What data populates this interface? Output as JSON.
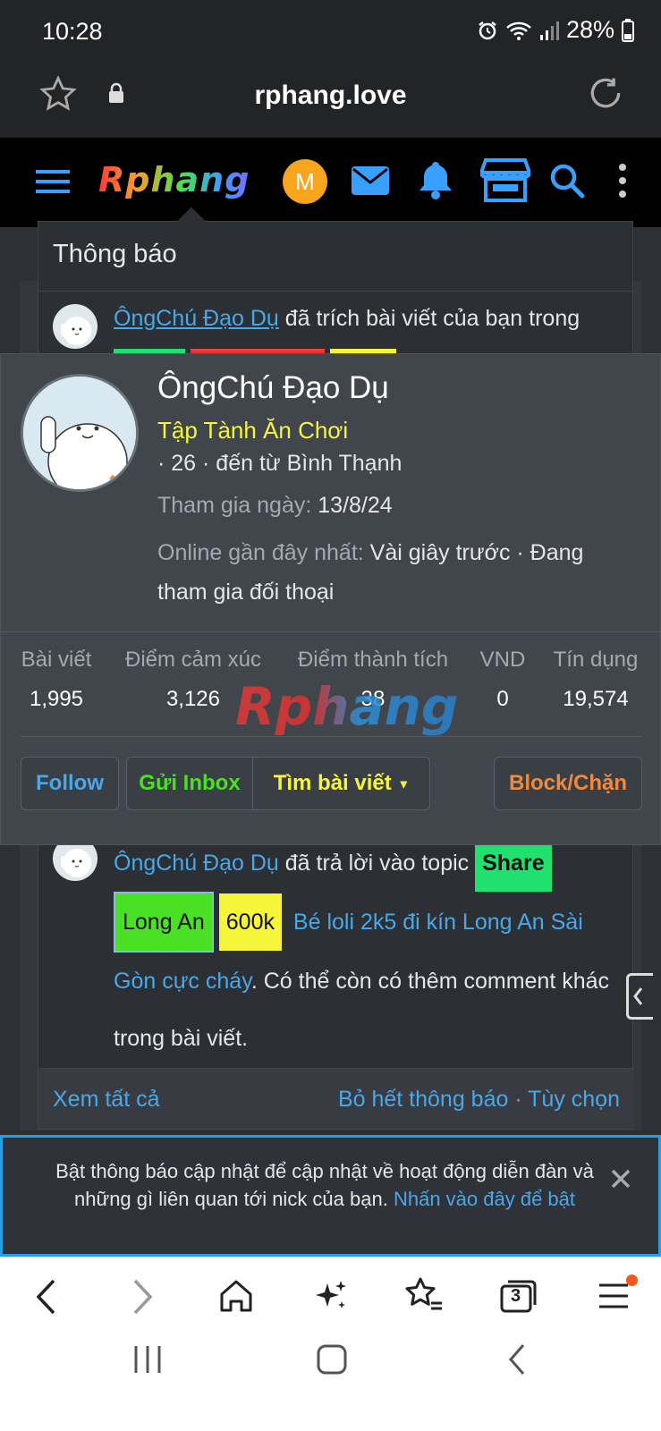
{
  "status": {
    "time": "10:28",
    "battery": "28%"
  },
  "browser": {
    "url": "rphang.love"
  },
  "site": {
    "logo": "Rphang",
    "avatar_letter": "M"
  },
  "notifications": {
    "title": "Thông báo",
    "item1": {
      "user": "ÔngChú Đạo Dụ",
      "text": " đã trích bài viết của bạn trong"
    },
    "item2": {
      "user": "ÔngChú Đạo Dụ",
      "text1": " đã trả lời vào topic ",
      "tag_share": "Share",
      "tag_longan": "Long An",
      "tag_600k": "600k",
      "link": " Bé loli 2k5 đi kín Long An Sài Gòn cực cháy",
      "text2": ". Có thể còn có thêm comment khác trong bài viết."
    },
    "footer": {
      "view_all": "Xem tất cả",
      "dismiss_all": "Bỏ hết thông báo",
      "sep": " · ",
      "options": "Tùy chọn"
    }
  },
  "profile": {
    "name": "ÔngChú Đạo Dụ",
    "rank": "Tập Tành Ăn Chơi",
    "age_location": "· 26 · đến từ Bình Thạnh",
    "joined_label": "Tham gia ngày:",
    "joined_value": " 13/8/24",
    "online_label": "Online gần đây nhất:",
    "online_value": " Vài giây trước · Đang tham gia đối thoại",
    "watermark": "Rphang",
    "stats": [
      {
        "label": "Bài viết",
        "value": "1,995"
      },
      {
        "label": "Điểm cảm xúc",
        "value": "3,126"
      },
      {
        "label": "Điểm thành tích",
        "value": "38"
      },
      {
        "label": "VND",
        "value": "0"
      },
      {
        "label": "Tín dụng",
        "value": "19,574"
      }
    ],
    "buttons": {
      "follow": "Follow",
      "inbox": "Gửi Inbox",
      "find_posts": "Tìm bài viết",
      "block": "Block/Chặn"
    }
  },
  "banner": {
    "text": "Bật thông báo cập nhật để cập nhật về hoạt động diễn đàn và những gì liên quan tới nick của bạn.",
    "link": " Nhấn vào đây để bật"
  },
  "navbar": {
    "tabs_count": "3"
  },
  "colors": {
    "accent_blue": "#4aa8e8",
    "rank_yellow": "#f5f53a",
    "follow_blue": "#4aa8e8",
    "inbox_green": "#4ae024",
    "find_yellow": "#f5f53a",
    "block_orange": "#f08a3c"
  }
}
